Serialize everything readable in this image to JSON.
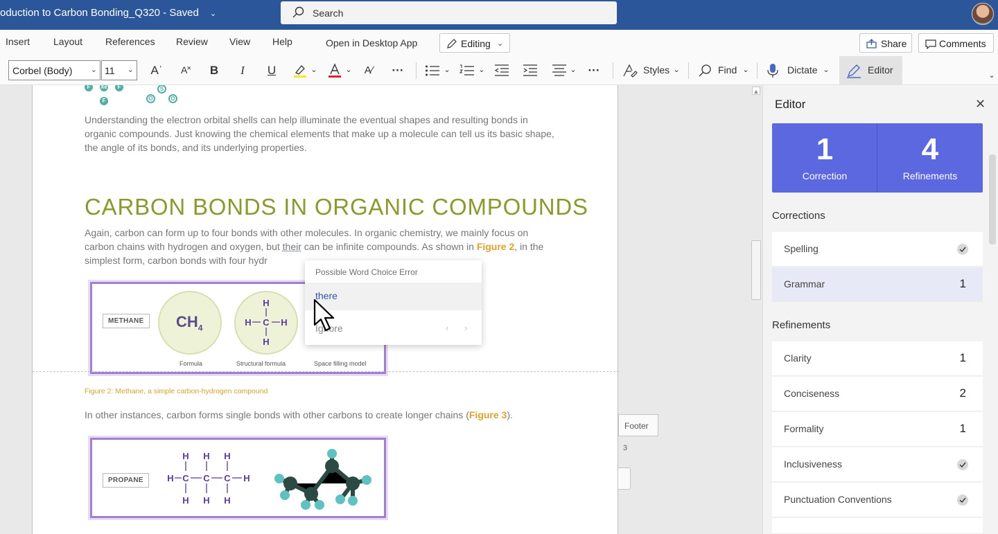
{
  "app": {
    "doc_title": "oduction to Carbon Bonding_Q320  -  Saved",
    "search_placeholder": "Search"
  },
  "ribbon": {
    "tabs": [
      "Insert",
      "Layout",
      "References",
      "Review",
      "View",
      "Help"
    ],
    "open_desktop": "Open in Desktop App",
    "editing": "Editing",
    "share": "Share",
    "comments": "Comments"
  },
  "toolbar": {
    "font": "Corbel (Body)",
    "size": "11",
    "styles": "Styles",
    "find": "Find",
    "dictate": "Dictate",
    "editor": "Editor"
  },
  "document": {
    "para1": "Understanding the electron orbital shells can help illuminate the eventual shapes and resulting bonds in organic compounds. Just knowing the chemical elements that make up a molecule can tell us its basic shape, the angle of its bonds, and its underlying properties.",
    "heading": "CARBON BONDS IN ORGANIC COMPOUNDS",
    "para2_a": "Again, carbon can form up to four bonds with other molecules. In organic chemistry, we mainly focus on carbon chains with hydrogen and oxygen, but ",
    "para2_flag": "their",
    "para2_b": " can be infinite compounds. As shown in ",
    "para2_fig": "Figure 2",
    "para2_c": ", in the simplest form, carbon bonds with four hydr",
    "figure2": {
      "label": "METHANE",
      "formula": "CH",
      "formula_sub": "4",
      "cap_formula": "Formula",
      "cap_structural": "Structural formula",
      "cap_space": "Space filling model"
    },
    "caption2": "Figure 2: Methane, a simple carbon-hydrogen compound",
    "para3_a": "In other instances, carbon forms single bonds with other carbons to create longer chains (",
    "para3_fig": "Figure 3",
    "para3_b": ").",
    "figure3": {
      "label": "PROPANE"
    }
  },
  "popup": {
    "header": "Possible Word Choice Error",
    "suggestion": "there",
    "ignore": "Ignore"
  },
  "footer_marker": {
    "label": "Footer",
    "page_number": "3"
  },
  "editor_pane": {
    "title": "Editor",
    "corrections_count": "1",
    "corrections_label": "Correction",
    "refinements_count": "4",
    "refinements_label": "Refinements",
    "corrections_header": "Corrections",
    "refinements_header": "Refinements",
    "corrections": [
      {
        "label": "Spelling",
        "count": null
      },
      {
        "label": "Grammar",
        "count": "1"
      }
    ],
    "refinements": [
      {
        "label": "Clarity",
        "count": "1"
      },
      {
        "label": "Conciseness",
        "count": "2"
      },
      {
        "label": "Formality",
        "count": "1"
      },
      {
        "label": "Inclusiveness",
        "count": null
      },
      {
        "label": "Punctuation Conventions",
        "count": null
      }
    ]
  },
  "colors": {
    "titlebar": "#2b579a",
    "heading": "#8c9a2b",
    "accent_link": "#e0a12a",
    "editor_score": "#5b68e0",
    "figure_border": "#a37fd4"
  }
}
